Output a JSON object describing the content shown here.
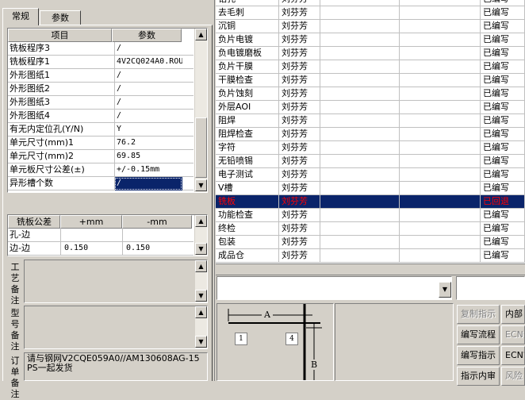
{
  "tabs": [
    "常规",
    "参数"
  ],
  "params": {
    "headers": [
      "项目",
      "参数"
    ],
    "rows": [
      [
        "铣板程序3",
        "/"
      ],
      [
        "铣板程序1",
        "4V2CQ024A0.ROU"
      ],
      [
        "外形图纸1",
        "/"
      ],
      [
        "外形图纸2",
        "/"
      ],
      [
        "外形图纸3",
        "/"
      ],
      [
        "外形图纸4",
        "/"
      ],
      [
        "有无内定位孔(Y/N)",
        "Y"
      ],
      [
        "单元尺寸(mm)1",
        "76.2"
      ],
      [
        "单元尺寸(mm)2",
        "69.85"
      ],
      [
        "单元板尺寸公差(±)",
        "+/-0.15mm"
      ],
      [
        "异形槽个数",
        "/"
      ]
    ]
  },
  "tolerance": {
    "headers": [
      "铣板公差",
      "+mm",
      "-mm"
    ],
    "rows": [
      [
        "孔-边",
        "",
        ""
      ],
      [
        "边-边",
        "0.150",
        "0.150"
      ]
    ]
  },
  "notes": {
    "process_label": "工艺备注",
    "model_label": "型号备注",
    "order_label": "订单备注",
    "order_text": "请与钢网V2CQE059A0//AM130608AG-15 PS一起发货"
  },
  "flow": {
    "rows": [
      [
        "钻孔",
        "刘芬芳",
        "已编写"
      ],
      [
        "去毛刺",
        "刘芬芳",
        "已编写"
      ],
      [
        "沉铜",
        "刘芬芳",
        "已编写"
      ],
      [
        "负片电镀",
        "刘芬芳",
        "已编写"
      ],
      [
        "负电镀磨板",
        "刘芬芳",
        "已编写"
      ],
      [
        "负片干膜",
        "刘芬芳",
        "已编写"
      ],
      [
        "干膜检查",
        "刘芬芳",
        "已编写"
      ],
      [
        "负片蚀刻",
        "刘芬芳",
        "已编写"
      ],
      [
        "外层AOI",
        "刘芬芳",
        "已编写"
      ],
      [
        "阻焊",
        "刘芬芳",
        "已编写"
      ],
      [
        "阻焊检查",
        "刘芬芳",
        "已编写"
      ],
      [
        "字符",
        "刘芬芳",
        "已编写"
      ],
      [
        "无铅喷锡",
        "刘芬芳",
        "已编写"
      ],
      [
        "电子测试",
        "刘芬芳",
        "已编写"
      ],
      [
        "V槽",
        "刘芬芳",
        "已编写"
      ],
      [
        "铣板",
        "刘芬芳",
        "已回退"
      ],
      [
        "功能检查",
        "刘芬芳",
        "已编写"
      ],
      [
        "终检",
        "刘芬芳",
        "已编写"
      ],
      [
        "包装",
        "刘芬芳",
        "已编写"
      ],
      [
        "成品仓",
        "刘芬芳",
        "已编写"
      ]
    ],
    "selected_index": 15
  },
  "diagram": {
    "label_a": "A",
    "label_b": "B",
    "box1": "1",
    "box4": "4"
  },
  "buttons": {
    "copy_instructions": "复制指示",
    "internal": "内部",
    "write_flow": "编写流程",
    "ecn_impact": "ECN影",
    "write_instructions": "编写指示",
    "ecn_review": "ECN审",
    "instructions_review": "指示内审",
    "risk": "风险"
  },
  "colors": {
    "selection_bg": "#0a246a",
    "selection_fg": "#ff0000",
    "window_bg": "#d4d0c8",
    "grid_bg": "#ffffff"
  }
}
